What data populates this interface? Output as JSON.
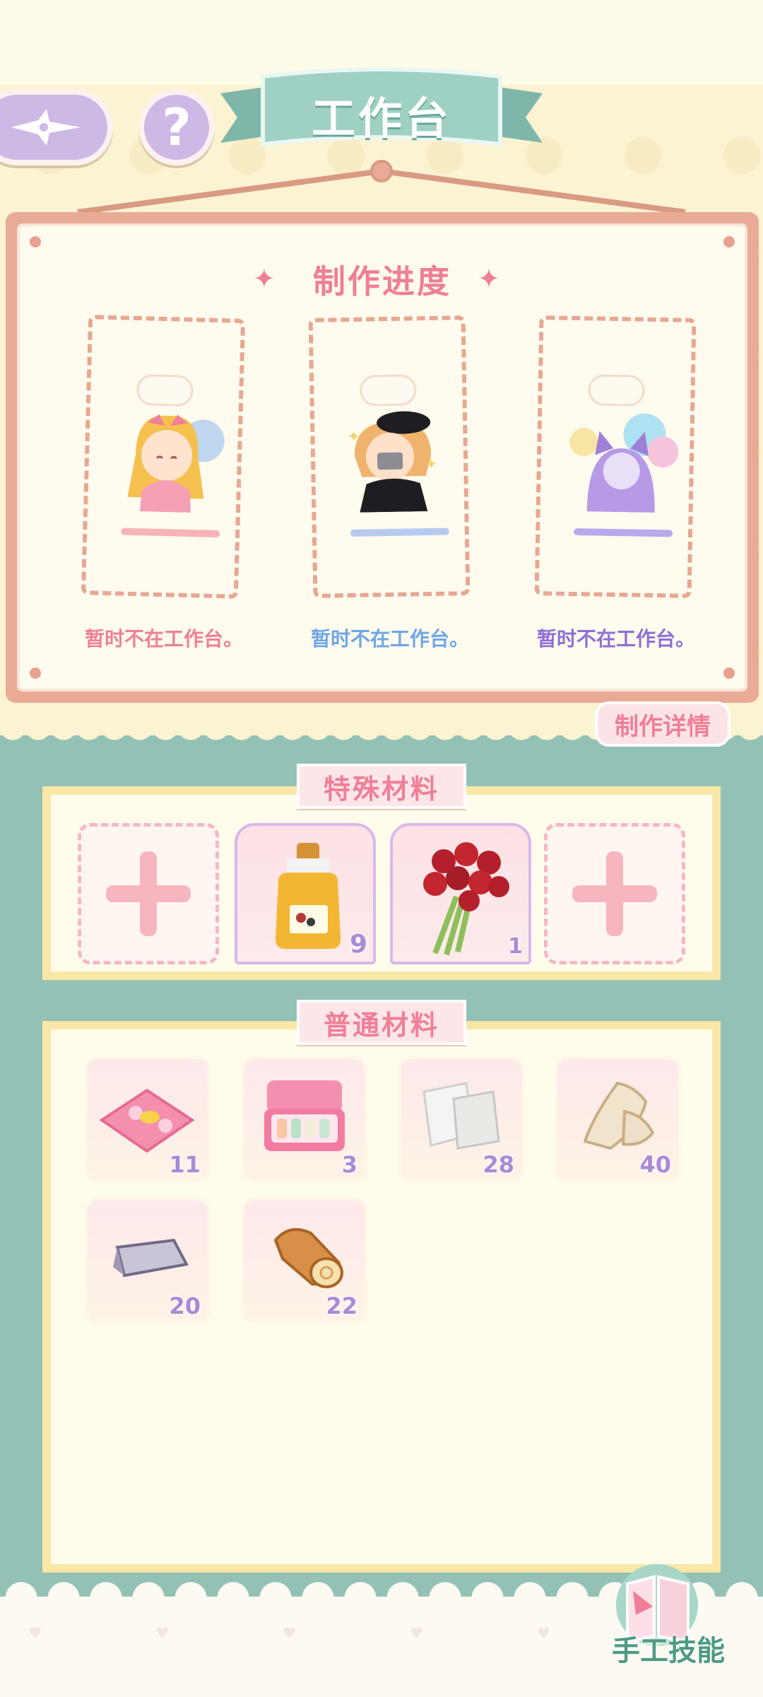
{
  "header": {
    "title": "工作台",
    "help_label": "?"
  },
  "progress": {
    "title": "制作进度",
    "slots": [
      {
        "status": "暂时不在工作台。",
        "color": "#ef7f97"
      },
      {
        "status": "暂时不在工作台。",
        "color": "#6fa6e6"
      },
      {
        "status": "暂时不在工作台。",
        "color": "#8e6fd6"
      }
    ],
    "detail_button": "制作详情"
  },
  "special_materials": {
    "label": "特殊材料",
    "items": [
      {
        "name": "honey-jar",
        "count": "9"
      },
      {
        "name": "rose-bouquet",
        "count": "1"
      }
    ]
  },
  "normal_materials": {
    "label": "普通材料",
    "items": [
      {
        "name": "bee-fabric",
        "count": "11"
      },
      {
        "name": "sewing-kit",
        "count": "3"
      },
      {
        "name": "white-cloth",
        "count": "28"
      },
      {
        "name": "fur-fabric",
        "count": "40"
      },
      {
        "name": "silver-ingot",
        "count": "20"
      },
      {
        "name": "wood-log",
        "count": "22"
      }
    ]
  },
  "footer": {
    "craft_skill_label": "手工技能"
  }
}
